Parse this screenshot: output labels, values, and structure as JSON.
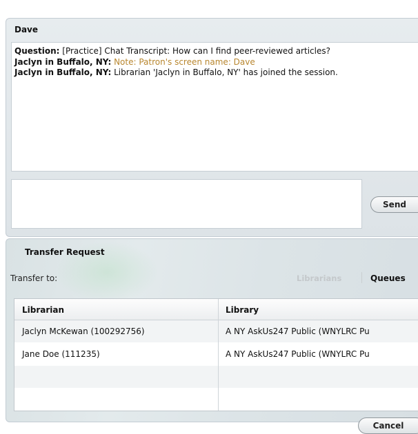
{
  "chat": {
    "patron_name": "Dave",
    "transcript": [
      {
        "speaker": "Question:",
        "text": " [Practice] Chat Transcript: How can I find peer-reviewed articles?",
        "note": false
      },
      {
        "speaker": "Jaclyn in Buffalo, NY:",
        "text": " Note: Patron's screen name: Dave",
        "note": true
      },
      {
        "speaker": "Jaclyn in Buffalo, NY:",
        "text": " Librarian 'Jaclyn in Buffalo, NY' has joined the session.",
        "note": false
      }
    ],
    "message_value": "",
    "send_label": "Send"
  },
  "transfer": {
    "title": "Transfer Request",
    "transfer_to_label": "Transfer to:",
    "tabs": {
      "librarians": "Librarians",
      "queues": "Queues"
    },
    "columns": {
      "librarian": "Librarian",
      "library": "Library"
    },
    "rows": [
      {
        "librarian": "Jaclyn McKewan (100292756)",
        "library": "A NY AskUs247 Public (WNYLRC Pu"
      },
      {
        "librarian": "Jane Doe (111235)",
        "library": "A NY AskUs247 Public (WNYLRC Pu"
      },
      {
        "librarian": "",
        "library": ""
      }
    ],
    "cancel_label": "Cancel"
  },
  "colors": {
    "note": "#b8862e",
    "panel": "#e3e8eb",
    "tab_inactive": "#c4c8cb"
  }
}
